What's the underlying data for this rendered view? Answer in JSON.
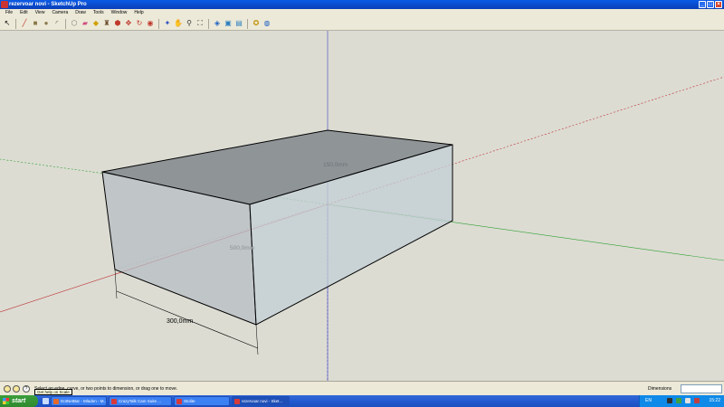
{
  "window": {
    "title": "rezervoar novi - SketchUp Pro"
  },
  "menu": [
    "File",
    "Edit",
    "View",
    "Camera",
    "Draw",
    "Tools",
    "Window",
    "Help"
  ],
  "toolbar": [
    {
      "name": "select-icon",
      "glyph": "↖",
      "color": "#000000"
    },
    {
      "sep": true
    },
    {
      "name": "line-icon",
      "glyph": "╱",
      "color": "#c0392b"
    },
    {
      "name": "rectangle-icon",
      "glyph": "■",
      "color": "#8a7a4a"
    },
    {
      "name": "circle-icon",
      "glyph": "●",
      "color": "#8a7a4a"
    },
    {
      "name": "arc-icon",
      "glyph": "◜",
      "color": "#555555"
    },
    {
      "sep": true
    },
    {
      "name": "make-component-icon",
      "glyph": "⬡",
      "color": "#777777"
    },
    {
      "name": "eraser-icon",
      "glyph": "▰",
      "color": "#d05080"
    },
    {
      "name": "tape-measure-icon",
      "glyph": "◆",
      "color": "#d0a000"
    },
    {
      "name": "paint-bucket-icon",
      "glyph": "♜",
      "color": "#6a4a2a"
    },
    {
      "name": "push-pull-icon",
      "glyph": "⬢",
      "color": "#c0392b"
    },
    {
      "name": "move-icon",
      "glyph": "✥",
      "color": "#c0392b"
    },
    {
      "name": "rotate-icon",
      "glyph": "↻",
      "color": "#c0392b"
    },
    {
      "name": "offset-icon",
      "glyph": "◉",
      "color": "#c0392b"
    },
    {
      "sep": true
    },
    {
      "name": "orbit-icon",
      "glyph": "✦",
      "color": "#3050c0"
    },
    {
      "name": "pan-icon",
      "glyph": "✋",
      "color": "#555555"
    },
    {
      "name": "zoom-icon",
      "glyph": "⚲",
      "color": "#333333"
    },
    {
      "name": "zoom-extents-icon",
      "glyph": "⛶",
      "color": "#333333"
    },
    {
      "sep": true
    },
    {
      "name": "get-models-icon",
      "glyph": "◈",
      "color": "#2060c0"
    },
    {
      "name": "share-model-icon",
      "glyph": "▣",
      "color": "#3080c0"
    },
    {
      "name": "share-component-icon",
      "glyph": "▤",
      "color": "#3080c0"
    },
    {
      "sep": true
    },
    {
      "name": "get-photo-texture-icon",
      "glyph": "✪",
      "color": "#c09000"
    },
    {
      "name": "preview-google-earth-icon",
      "glyph": "◍",
      "color": "#2060c0"
    }
  ],
  "model": {
    "dimensions": {
      "top": "150,0mm",
      "middle": "500,0mm",
      "bottom": "300,0mm"
    }
  },
  "status": {
    "text": "Select an edge, curve, or two points to dimension, or drag one to move.",
    "tooltip": "Get help on Scale"
  },
  "vcb": {
    "label": "Dimensions",
    "value": ""
  },
  "taskbar": {
    "start": "start",
    "tasks": [
      {
        "label": "DotNetBar - Mladen - M...",
        "color": "#e4692b"
      },
      {
        "label": "CrazyTalk Cam Suite ...",
        "color": "#d83a3a"
      },
      {
        "label": "Stolite",
        "color": "#d83a3a"
      },
      {
        "label": "rezervoar novi - Sket...",
        "color": "#d83a3a",
        "active": true
      }
    ],
    "lang": "EN",
    "clock": "15:22"
  }
}
